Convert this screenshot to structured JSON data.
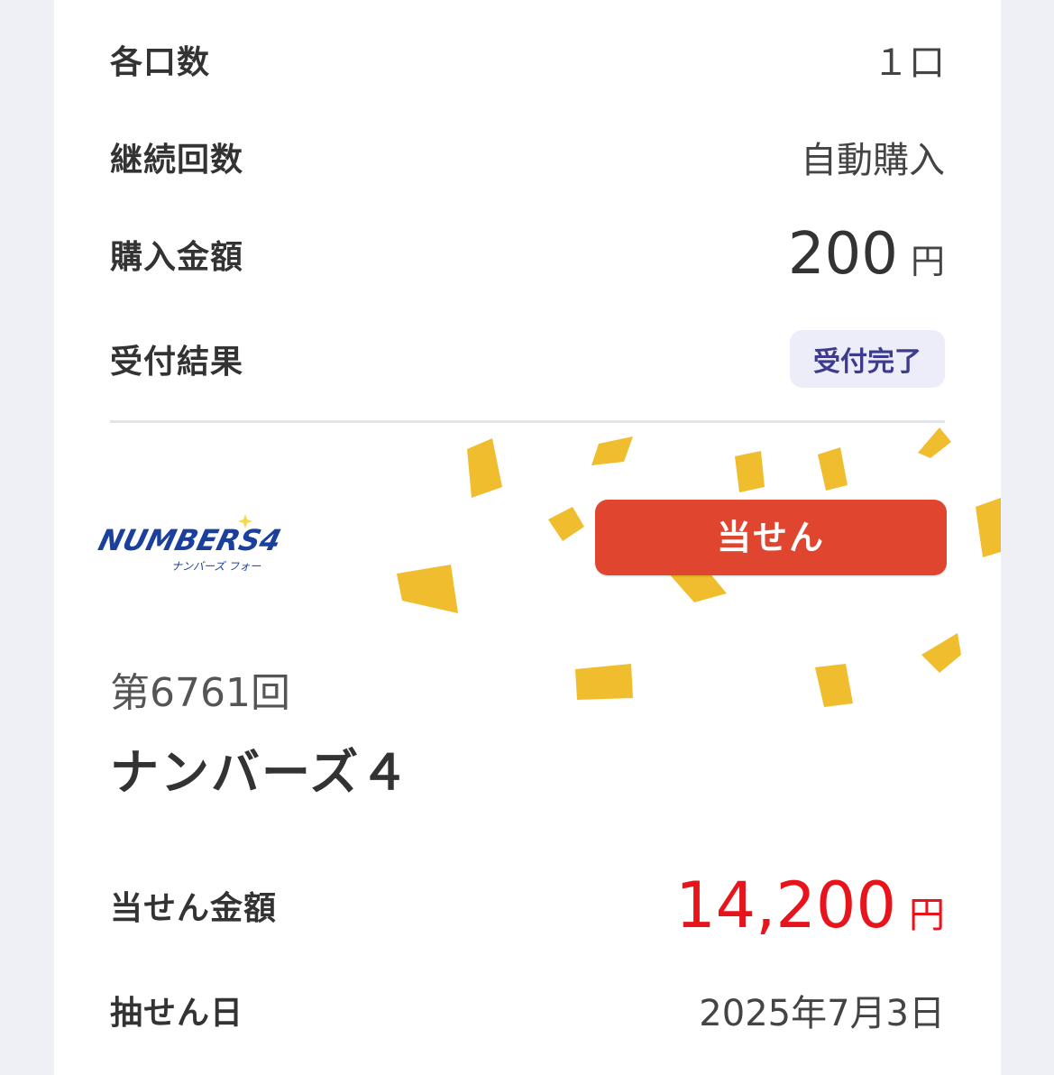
{
  "details": {
    "units_label": "各口数",
    "units_value": "１口",
    "continuation_label": "継続回数",
    "continuation_value": "自動購入",
    "purchase_label": "購入金額",
    "purchase_amount": "200",
    "purchase_unit": "円",
    "status_label": "受付結果",
    "status_badge": "受付完了"
  },
  "result": {
    "logo_text": "NUMBERS4",
    "logo_subtext": "ナンバーズ フォー",
    "win_button": "当せん",
    "round": "第6761回",
    "game_name": "ナンバーズ４",
    "prize_label": "当せん金額",
    "prize_amount": "14,200",
    "prize_unit": "円",
    "draw_label": "抽せん日",
    "draw_date": "2025年7月3日"
  },
  "colors": {
    "win_button": "#e0452f",
    "prize": "#e8141c",
    "badge_bg": "#ecedf8",
    "badge_text": "#3d3b8e",
    "confetti": "#f0bd2f",
    "logo_blue": "#1b3f9c",
    "logo_green": "#2aa639"
  }
}
